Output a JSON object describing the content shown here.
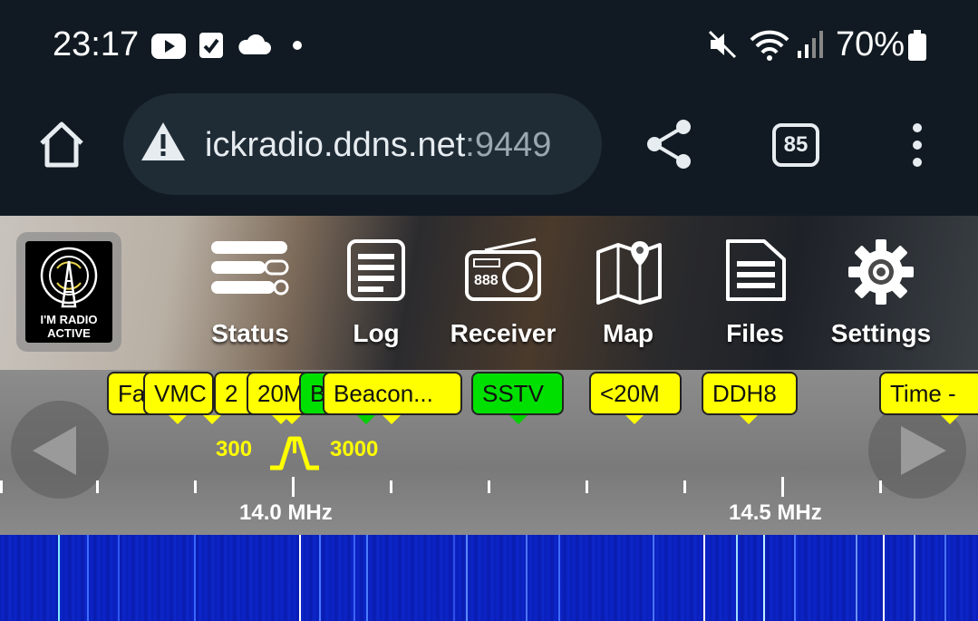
{
  "status_bar": {
    "time": "23:17",
    "battery": "70%",
    "icons": [
      "youtube-icon",
      "checkbox-icon",
      "cloud-icon",
      "dot-icon",
      "mute-icon",
      "wifi-icon",
      "signal-icon",
      "battery-icon"
    ]
  },
  "browser": {
    "url_host": "ickradio.ddns.net",
    "url_port": ":9449",
    "tab_count": "85"
  },
  "logo": {
    "line1": "I'M RADIO",
    "line2": "ACTIVE"
  },
  "nav": [
    {
      "label": "Status",
      "icon": "status-icon"
    },
    {
      "label": "Log",
      "icon": "log-icon"
    },
    {
      "label": "Receiver",
      "icon": "radio-icon"
    },
    {
      "label": "Map",
      "icon": "map-icon"
    },
    {
      "label": "Files",
      "icon": "files-icon"
    },
    {
      "label": "Settings",
      "icon": "gear-icon"
    }
  ],
  "bookmarks": [
    {
      "label": "Fa",
      "color": "#ffff00"
    },
    {
      "label": "VMC",
      "color": "#ffff00"
    },
    {
      "label": "2",
      "color": "#ffff00"
    },
    {
      "label": "20M",
      "color": "#ffff00"
    },
    {
      "label": "B",
      "color": "#00e000"
    },
    {
      "label": "Beacon...",
      "color": "#ffff00"
    },
    {
      "label": "SSTV",
      "color": "#00e000"
    },
    {
      "label": "<20M",
      "color": "#ffff00"
    },
    {
      "label": "DDH8",
      "color": "#ffff00"
    },
    {
      "label": "Time -",
      "color": "#ffff00"
    }
  ],
  "passband": {
    "low": "300",
    "high": "3000"
  },
  "scale": {
    "label_1": "14.0 MHz",
    "label_2": "14.5 MHz"
  },
  "colors": {
    "bookmark_yellow": "#ffff00",
    "bookmark_green": "#00e000",
    "waterfall_blue": "#0a1fb8"
  }
}
